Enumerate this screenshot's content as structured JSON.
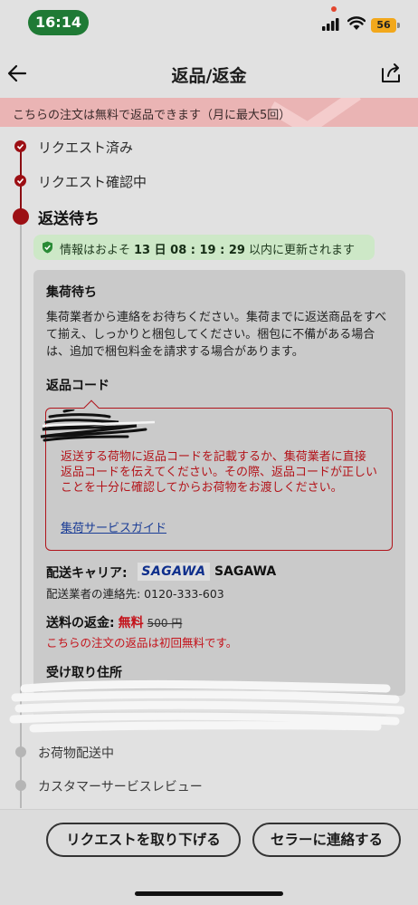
{
  "status_bar": {
    "time": "16:14",
    "battery": "56"
  },
  "header": {
    "title": "返品/返金"
  },
  "banner": {
    "text": "こちらの注文は無料で返品できます（月に最大5回）"
  },
  "timeline": {
    "steps": [
      {
        "label": "リクエスト済み"
      },
      {
        "label": "リクエスト確認中"
      },
      {
        "label": "返送待ち"
      },
      {
        "label": "お荷物配送中"
      },
      {
        "label": "カスタマーサービスレビュー"
      }
    ]
  },
  "info": {
    "prefix": "情報はおよそ",
    "countdown": "13 日 08 : 19 : 29",
    "suffix": "以内に更新されます"
  },
  "card": {
    "pickup_title": "集荷待ち",
    "pickup_text": "集荷業者から連絡をお待ちください。集荷までに返送商品をすべて揃え、しっかりと梱包してください。梱包に不備がある場合は、追加で梱包料金を請求する場合があります。",
    "code_title": "返品コード",
    "code_warning": "返送する荷物に返品コードを記載するか、集荷業者に直接返品コードを伝えてください。その際、返品コードが正しいことを十分に確認してからお荷物をお渡しください。",
    "guide_link": "集荷サービスガイド",
    "carrier_label": "配送キャリア:",
    "carrier_logo": "SAGAWA",
    "carrier_name": "SAGAWA",
    "carrier_contact": "配送業者の連絡先: 0120-333-603",
    "refund_label": "送料の返金:",
    "refund_free": "無料",
    "refund_original": "500 円",
    "refund_note": "こちらの注文の返品は初回無料です。",
    "address_title": "受け取り住所"
  },
  "actions": {
    "withdraw": "リクエストを取り下げる",
    "contact_seller": "セラーに連絡する"
  }
}
